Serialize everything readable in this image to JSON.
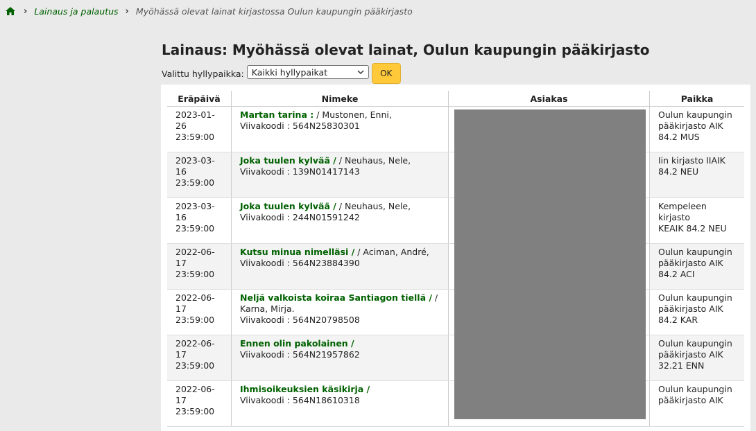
{
  "breadcrumb": {
    "home_icon": "home-icon",
    "link": "Lainaus ja palautus",
    "current": "Myöhässä olevat lainat kirjastossa Oulun kaupungin pääkirjasto"
  },
  "page_title": "Lainaus: Myöhässä olevat lainat, Oulun kaupungin pääkirjasto",
  "filter": {
    "label": "Valittu hyllypaikka:",
    "selected": "Kaikki hyllypaikat",
    "ok_label": "OK"
  },
  "table": {
    "headers": [
      "Eräpäivä",
      "Nimeke",
      "Asiakas",
      "Paikka"
    ],
    "rows": [
      {
        "date": "2023-01-26",
        "time": "23:59:00",
        "title": "Martan tarina :",
        "author": " / Mustonen, Enni,",
        "barcode": "Viivakoodi : 564N25830301",
        "location": [
          "Oulun kaupungin",
          "pääkirjasto AIK",
          "84.2 MUS"
        ]
      },
      {
        "date": "2023-03-16",
        "time": "23:59:00",
        "title": "Joka tuulen kylvää /",
        "author": " / Neuhaus, Nele,",
        "barcode": "Viivakoodi : 139N01417143",
        "location": [
          "Iin kirjasto IIAIK",
          "84.2 NEU",
          ""
        ]
      },
      {
        "date": "2023-03-16",
        "time": "23:59:00",
        "title": "Joka tuulen kylvää /",
        "author": " / Neuhaus, Nele,",
        "barcode": "Viivakoodi : 244N01591242",
        "location": [
          "Kempeleen kirjasto",
          "KEAIK 84.2 NEU",
          ""
        ]
      },
      {
        "date": "2022-06-17",
        "time": "23:59:00",
        "title": "Kutsu minua nimelläsi /",
        "author": " / Aciman, André,",
        "barcode": "Viivakoodi : 564N23884390",
        "location": [
          "Oulun kaupungin",
          "pääkirjasto AIK",
          "84.2 ACI"
        ]
      },
      {
        "date": "2022-06-17",
        "time": "23:59:00",
        "title": "Neljä valkoista koiraa Santiagon tiellä /",
        "author": " /",
        "author2": "Karna, Mirja.",
        "barcode": "Viivakoodi : 564N20798508",
        "location": [
          "Oulun kaupungin",
          "pääkirjasto AIK",
          "84.2 KAR"
        ]
      },
      {
        "date": "2022-06-17",
        "time": "23:59:00",
        "title": "Ennen olin pakolainen /",
        "author": "",
        "barcode": "Viivakoodi : 564N21957862",
        "location": [
          "Oulun kaupungin",
          "pääkirjasto AIK",
          "32.21 ENN"
        ]
      },
      {
        "date": "2022-06-17",
        "time": "23:59:00",
        "title": "Ihmisoikeuksien käsikirja /",
        "author": "",
        "barcode": "Viivakoodi : 564N18610318",
        "location": [
          "Oulun kaupungin",
          "pääkirjasto AIK",
          ""
        ]
      }
    ]
  },
  "colors": {
    "link": "#006100",
    "button": "#ffc93a",
    "redaction": "#808080"
  }
}
